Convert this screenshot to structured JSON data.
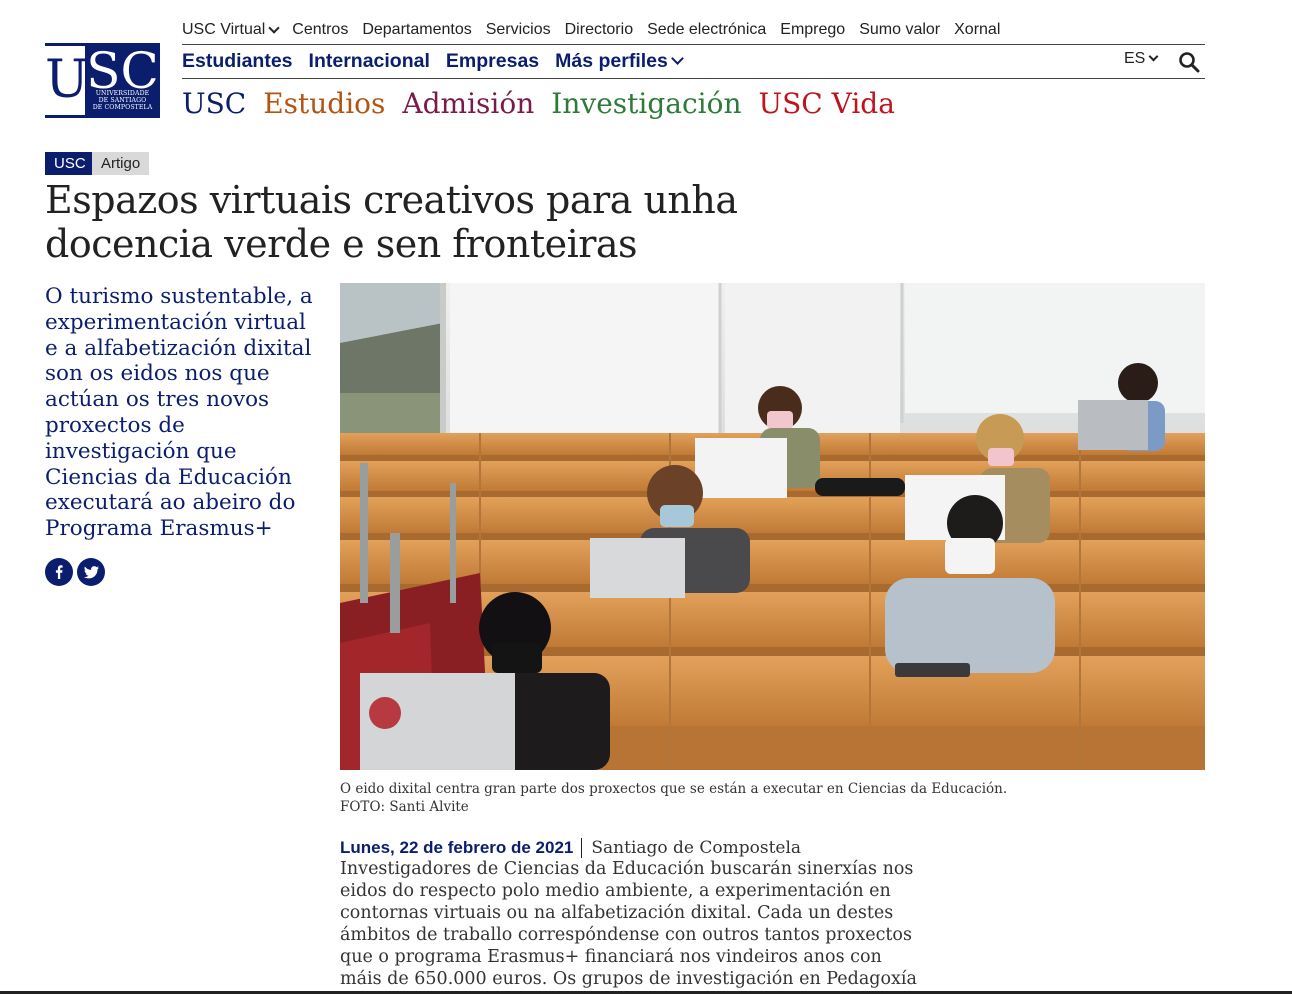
{
  "logo": {
    "letters_left": "U",
    "letters_right": "SC",
    "subtitle_lines": [
      "UNIVERSIDADE",
      "DE SANTIAGO",
      "DE COMPOSTELA"
    ]
  },
  "util_nav": [
    {
      "label": "USC Virtual",
      "dropdown": true
    },
    {
      "label": "Centros"
    },
    {
      "label": "Departamentos"
    },
    {
      "label": "Servicios"
    },
    {
      "label": "Directorio"
    },
    {
      "label": "Sede electrónica"
    },
    {
      "label": "Emprego"
    },
    {
      "label": "Sumo valor"
    },
    {
      "label": "Xornal"
    }
  ],
  "profile_nav": [
    {
      "label": "Estudiantes"
    },
    {
      "label": "Internacional"
    },
    {
      "label": "Empresas"
    },
    {
      "label": "Más perfiles",
      "dropdown": true
    }
  ],
  "language": "ES",
  "search_icon": "search-icon",
  "main_nav": [
    {
      "label": "USC",
      "color": "#0b1e6e"
    },
    {
      "label": "Estudios",
      "color": "#b35512"
    },
    {
      "label": "Admisión",
      "color": "#7a1a4a"
    },
    {
      "label": "Investigación",
      "color": "#2e7a3a"
    },
    {
      "label": "USC Vida",
      "color": "#c0141c"
    }
  ],
  "tags": {
    "primary": "USC",
    "secondary": "Artigo"
  },
  "article": {
    "title": "Espazos virtuais creativos para unha docencia verde e sen fronteiras",
    "lead": "O turismo sustentable, a experimentación virtual e a alfabetización dixital son os eidos nos que actúan os tres novos proxectos de investigación que Ciencias da Educación executará ao abeiro do Programa Erasmus+",
    "caption_line1": "O eido dixital centra gran parte dos proxectos que se están a executar en Ciencias da Educación.",
    "caption_line2": "FOTO: Santi Alvite",
    "date": "Lunes, 22 de febrero de 2021",
    "place": "Santiago de Compostela",
    "body": "Investigadores de Ciencias da Educación buscarán sinerxías nos eidos do respecto polo medio ambiente, a experimentación en contornas virtuais ou na alfabetización dixital. Cada un destes ámbitos de traballo correspóndense con outros tantos proxectos que o programa Erasmus+ financiará nos vindeiros anos con máis de 650.000 euros. Os grupos de investigación en Pedagoxía Social e"
  },
  "social": {
    "facebook_icon": "facebook-icon",
    "twitter_icon": "twitter-icon"
  },
  "colors": {
    "brand": "#0b1e6e"
  }
}
